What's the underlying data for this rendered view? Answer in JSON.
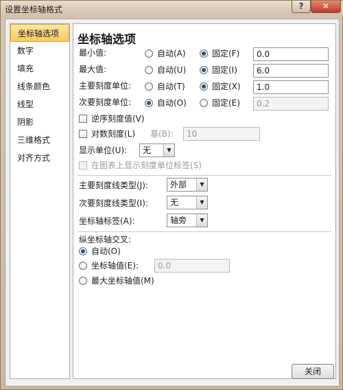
{
  "window": {
    "title": "设置坐标轴格式"
  },
  "nav": {
    "items": [
      {
        "label": "坐标轴选项",
        "selected": true
      },
      {
        "label": "数字",
        "selected": false
      },
      {
        "label": "填充",
        "selected": false
      },
      {
        "label": "线条颜色",
        "selected": false
      },
      {
        "label": "线型",
        "selected": false
      },
      {
        "label": "阴影",
        "selected": false
      },
      {
        "label": "三维格式",
        "selected": false
      },
      {
        "label": "对齐方式",
        "selected": false
      }
    ]
  },
  "panel": {
    "title": "坐标轴选项",
    "min": {
      "label": "最小值:",
      "auto_label": "自动(A)",
      "fixed_label": "固定(F)",
      "value": "0.0",
      "mode": "fixed"
    },
    "max": {
      "label": "最大值:",
      "auto_label": "自动(U)",
      "fixed_label": "固定(I)",
      "value": "6.0",
      "mode": "fixed"
    },
    "major_unit": {
      "label": "主要刻度单位:",
      "auto_label": "自动(T)",
      "fixed_label": "固定(X)",
      "value": "1.0",
      "mode": "fixed"
    },
    "minor_unit": {
      "label": "次要刻度单位:",
      "auto_label": "自动(O)",
      "fixed_label": "固定(E)",
      "value": "0.2",
      "mode": "auto"
    },
    "reverse_label": "逆序刻度值(V)",
    "log_label": "对数刻度(L)",
    "base_label": "基(B):",
    "base_value": "10",
    "display_units_label": "显示单位(U):",
    "display_units_value": "无",
    "show_units_label": "在图表上显示刻度单位标签(S)",
    "major_tick_label": "主要刻度线类型(J):",
    "major_tick_value": "外部",
    "minor_tick_label": "次要刻度线类型(I):",
    "minor_tick_value": "无",
    "axis_labels_label": "坐标轴标签(A):",
    "axis_labels_value": "轴旁",
    "cross_title": "纵坐标轴交叉:",
    "cross_auto_label": "自动(O)",
    "cross_value_label": "坐标轴值(E):",
    "cross_value": "0.0",
    "cross_max_label": "最大坐标轴值(M)"
  },
  "footer": {
    "close_label": "关闭"
  }
}
